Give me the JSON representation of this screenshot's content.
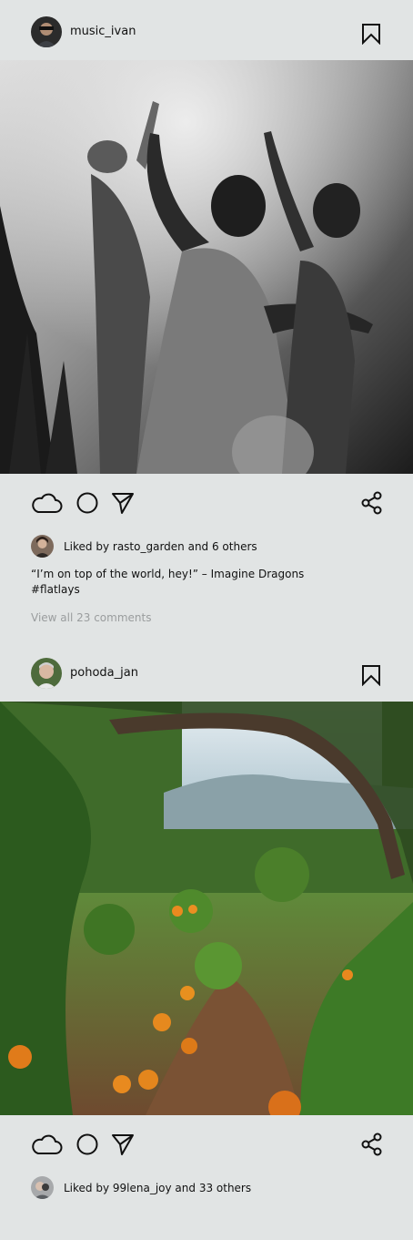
{
  "feed": {
    "posts": [
      {
        "username": "music_ivan",
        "likes_text": "Liked by rasto_garden and 6 others",
        "caption_line1": "“I’m on top of the world, hey!” – Imagine Dragons",
        "caption_line2": "#flatlays",
        "view_comments": "View all 23 comments"
      },
      {
        "username": "pohoda_jan",
        "likes_text": "Liked by 99lena_joy and 33 others"
      }
    ]
  },
  "icons": {
    "like": "cloud-icon",
    "comment": "circle-icon",
    "send": "send-icon",
    "share": "share-icon",
    "bookmark": "bookmark-icon"
  },
  "colors": {
    "background": "#e1e4e4",
    "text": "#111111",
    "muted": "#9a9d9e"
  }
}
